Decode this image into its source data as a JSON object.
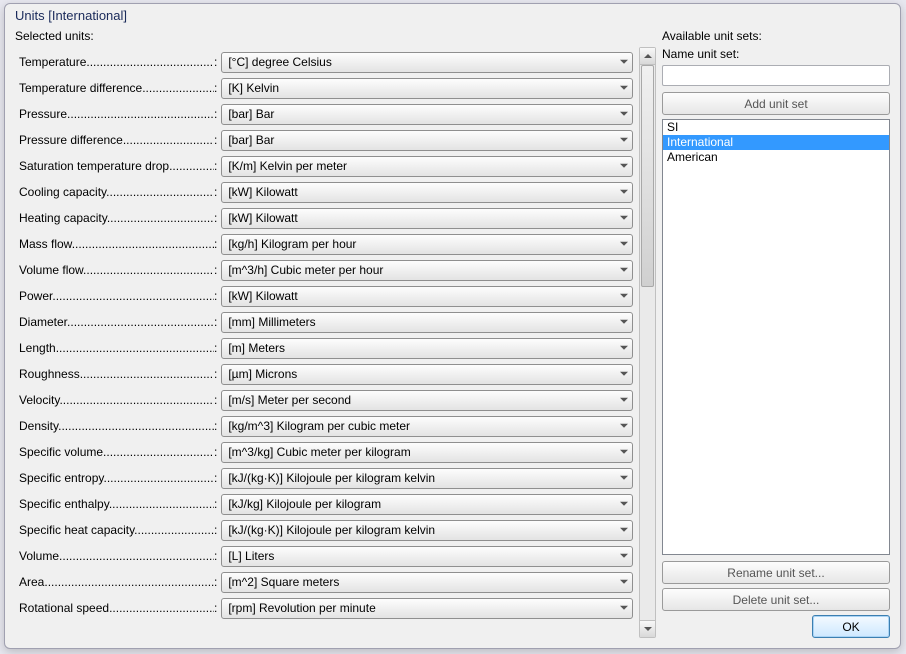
{
  "window": {
    "title": "Units [International]"
  },
  "labels": {
    "selected_units": "Selected units:",
    "available_unit_sets": "Available unit sets:",
    "name_unit_set": "Name unit set:"
  },
  "buttons": {
    "add_unit_set": "Add unit set",
    "rename_unit_set": "Rename unit set...",
    "delete_unit_set": "Delete unit set...",
    "ok": "OK"
  },
  "name_input": {
    "value": ""
  },
  "unit_sets": {
    "items": [
      "SI",
      "International",
      "American"
    ],
    "selected_index": 1
  },
  "units": [
    {
      "label": "Temperature",
      "value": "[°C] degree Celsius"
    },
    {
      "label": "Temperature difference",
      "value": "[K] Kelvin"
    },
    {
      "label": "Pressure",
      "value": "[bar] Bar"
    },
    {
      "label": "Pressure difference",
      "value": "[bar] Bar"
    },
    {
      "label": "Saturation temperature drop",
      "value": "[K/m] Kelvin per meter"
    },
    {
      "label": "Cooling capacity",
      "value": "[kW] Kilowatt"
    },
    {
      "label": "Heating capacity",
      "value": "[kW] Kilowatt"
    },
    {
      "label": "Mass flow",
      "value": "[kg/h] Kilogram per hour"
    },
    {
      "label": "Volume flow",
      "value": "[m^3/h] Cubic meter per hour"
    },
    {
      "label": "Power",
      "value": "[kW] Kilowatt"
    },
    {
      "label": "Diameter",
      "value": "[mm] Millimeters"
    },
    {
      "label": "Length",
      "value": "[m] Meters"
    },
    {
      "label": "Roughness",
      "value": "[µm] Microns"
    },
    {
      "label": "Velocity",
      "value": "[m/s] Meter per second"
    },
    {
      "label": "Density",
      "value": "[kg/m^3] Kilogram per cubic meter"
    },
    {
      "label": "Specific volume",
      "value": "[m^3/kg] Cubic meter per kilogram"
    },
    {
      "label": "Specific entropy",
      "value": "[kJ/(kg·K)] Kilojoule per kilogram kelvin"
    },
    {
      "label": "Specific enthalpy",
      "value": "[kJ/kg] Kilojoule per kilogram"
    },
    {
      "label": "Specific heat capacity",
      "value": "[kJ/(kg·K)] Kilojoule per kilogram kelvin"
    },
    {
      "label": "Volume",
      "value": "[L] Liters"
    },
    {
      "label": "Area",
      "value": "[m^2] Square meters"
    },
    {
      "label": "Rotational speed",
      "value": "[rpm] Revolution per minute"
    }
  ]
}
